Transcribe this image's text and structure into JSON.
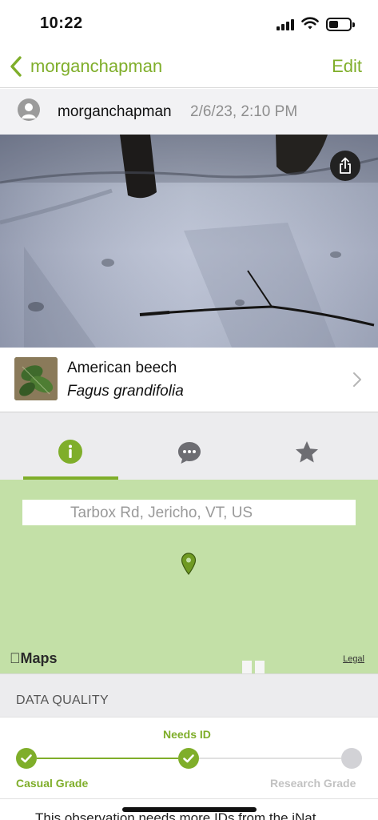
{
  "status_bar": {
    "time": "10:22",
    "battery_level": 0.4
  },
  "nav": {
    "back_label": "morganchapman",
    "edit_label": "Edit"
  },
  "observation": {
    "user": "morganchapman",
    "date": "2/6/23, 2:10 PM"
  },
  "taxon": {
    "common_name": "American beech",
    "scientific_name": "Fagus grandifolia"
  },
  "tabs": [
    {
      "id": "info",
      "icon": "info-icon",
      "active": true
    },
    {
      "id": "activity",
      "icon": "chat-bubble-icon",
      "active": false
    },
    {
      "id": "favorite",
      "icon": "star-icon",
      "active": false
    }
  ],
  "map": {
    "place_name": "Tarbox Rd, Jericho, VT, US",
    "attribution": "Maps",
    "legal_label": "Legal"
  },
  "data_quality": {
    "title": "DATA QUALITY",
    "steps": [
      {
        "label": "Casual Grade",
        "state": "done"
      },
      {
        "label": "Needs ID",
        "state": "done"
      },
      {
        "label": "Research Grade",
        "state": "pending"
      }
    ]
  },
  "footer_text": "This observation needs more IDs from the iNat",
  "colors": {
    "accent": "#7fae2a",
    "map_green": "#c3e0a7",
    "tab_bar": "#ececee"
  }
}
